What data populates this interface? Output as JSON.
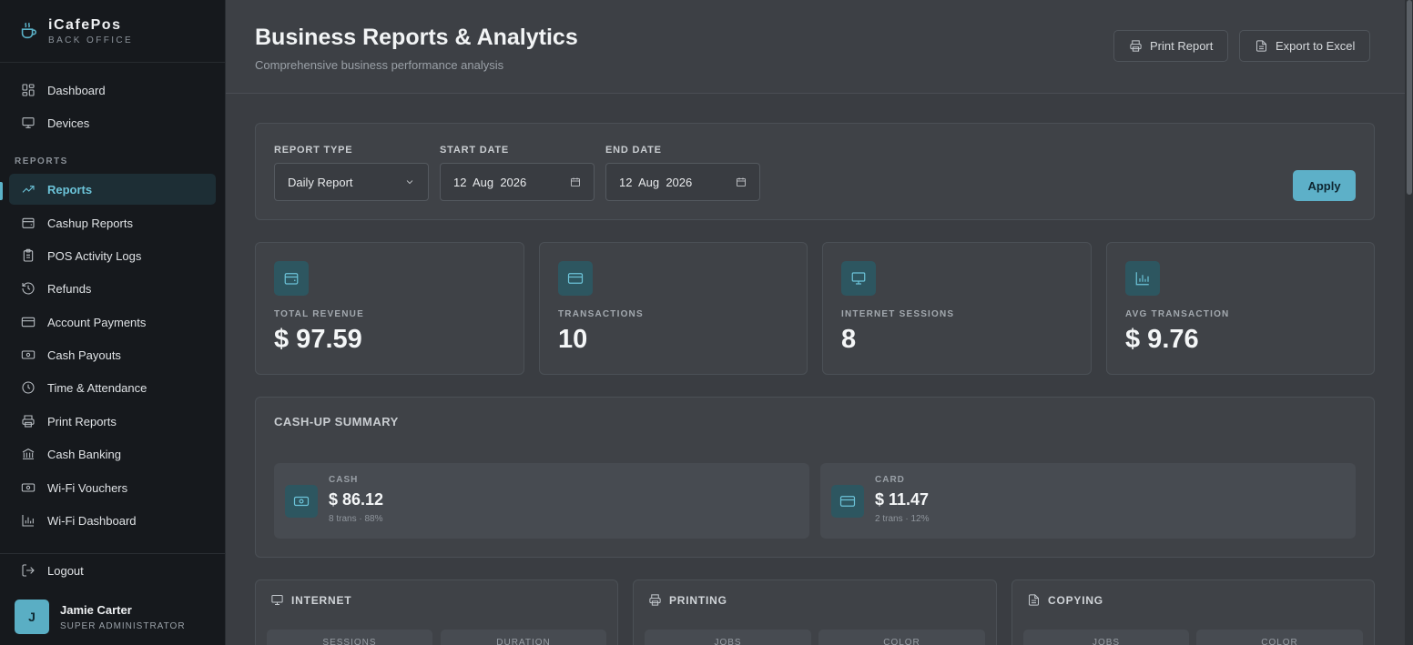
{
  "brand": {
    "name": "iCafePos",
    "subtitle": "BACK OFFICE"
  },
  "nav": {
    "top": [
      {
        "label": "Dashboard",
        "icon": "dashboard-icon"
      },
      {
        "label": "Devices",
        "icon": "monitor-icon"
      }
    ],
    "section_label": "REPORTS",
    "reports": [
      {
        "label": "Reports",
        "icon": "trending-up-icon",
        "active": true
      },
      {
        "label": "Cashup Reports",
        "icon": "wallet-icon"
      },
      {
        "label": "POS Activity Logs",
        "icon": "clipboard-icon"
      },
      {
        "label": "Refunds",
        "icon": "history-icon"
      },
      {
        "label": "Account Payments",
        "icon": "credit-card-icon"
      },
      {
        "label": "Cash Payouts",
        "icon": "banknote-icon"
      },
      {
        "label": "Time & Attendance",
        "icon": "clock-icon"
      },
      {
        "label": "Print Reports",
        "icon": "printer-icon"
      },
      {
        "label": "Cash Banking",
        "icon": "bank-icon"
      },
      {
        "label": "Wi-Fi Vouchers",
        "icon": "ticket-icon"
      },
      {
        "label": "Wi-Fi Dashboard",
        "icon": "bar-chart-icon"
      }
    ],
    "logout": "Logout"
  },
  "user": {
    "initial": "J",
    "name": "Jamie Carter",
    "role": "SUPER ADMINISTRATOR"
  },
  "header": {
    "title": "Business Reports & Analytics",
    "subtitle": "Comprehensive business performance analysis",
    "print_label": "Print Report",
    "export_label": "Export to Excel"
  },
  "filters": {
    "report_type_label": "REPORT TYPE",
    "report_type_value": "Daily Report",
    "start_date_label": "START DATE",
    "start_date_value": "12  Aug  2026",
    "end_date_label": "END DATE",
    "end_date_value": "12  Aug  2026",
    "apply_label": "Apply"
  },
  "stats": [
    {
      "label": "TOTAL REVENUE",
      "value": "$ 97.59",
      "icon": "wallet-icon"
    },
    {
      "label": "TRANSACTIONS",
      "value": "10",
      "icon": "credit-card-icon"
    },
    {
      "label": "INTERNET SESSIONS",
      "value": "8",
      "icon": "monitor-icon"
    },
    {
      "label": "AVG TRANSACTION",
      "value": "$ 9.76",
      "icon": "bar-chart-icon"
    }
  ],
  "cashup": {
    "title": "CASH-UP SUMMARY",
    "items": [
      {
        "label": "CASH",
        "value": "$ 86.12",
        "meta": "8 trans · 88%",
        "icon": "banknote-icon"
      },
      {
        "label": "CARD",
        "value": "$ 11.47",
        "meta": "2 trans · 12%",
        "icon": "credit-card-icon"
      }
    ]
  },
  "categories": [
    {
      "title": "INTERNET",
      "icon": "monitor-icon",
      "sub": [
        "SESSIONS",
        "DURATION"
      ]
    },
    {
      "title": "PRINTING",
      "icon": "printer-icon",
      "sub": [
        "JOBS",
        "COLOR"
      ]
    },
    {
      "title": "COPYING",
      "icon": "document-icon",
      "sub": [
        "JOBS",
        "COLOR"
      ]
    }
  ],
  "colors": {
    "accent": "#5db0c8",
    "sidebar_bg": "#16191d",
    "content_bg": "#3a3d42"
  }
}
